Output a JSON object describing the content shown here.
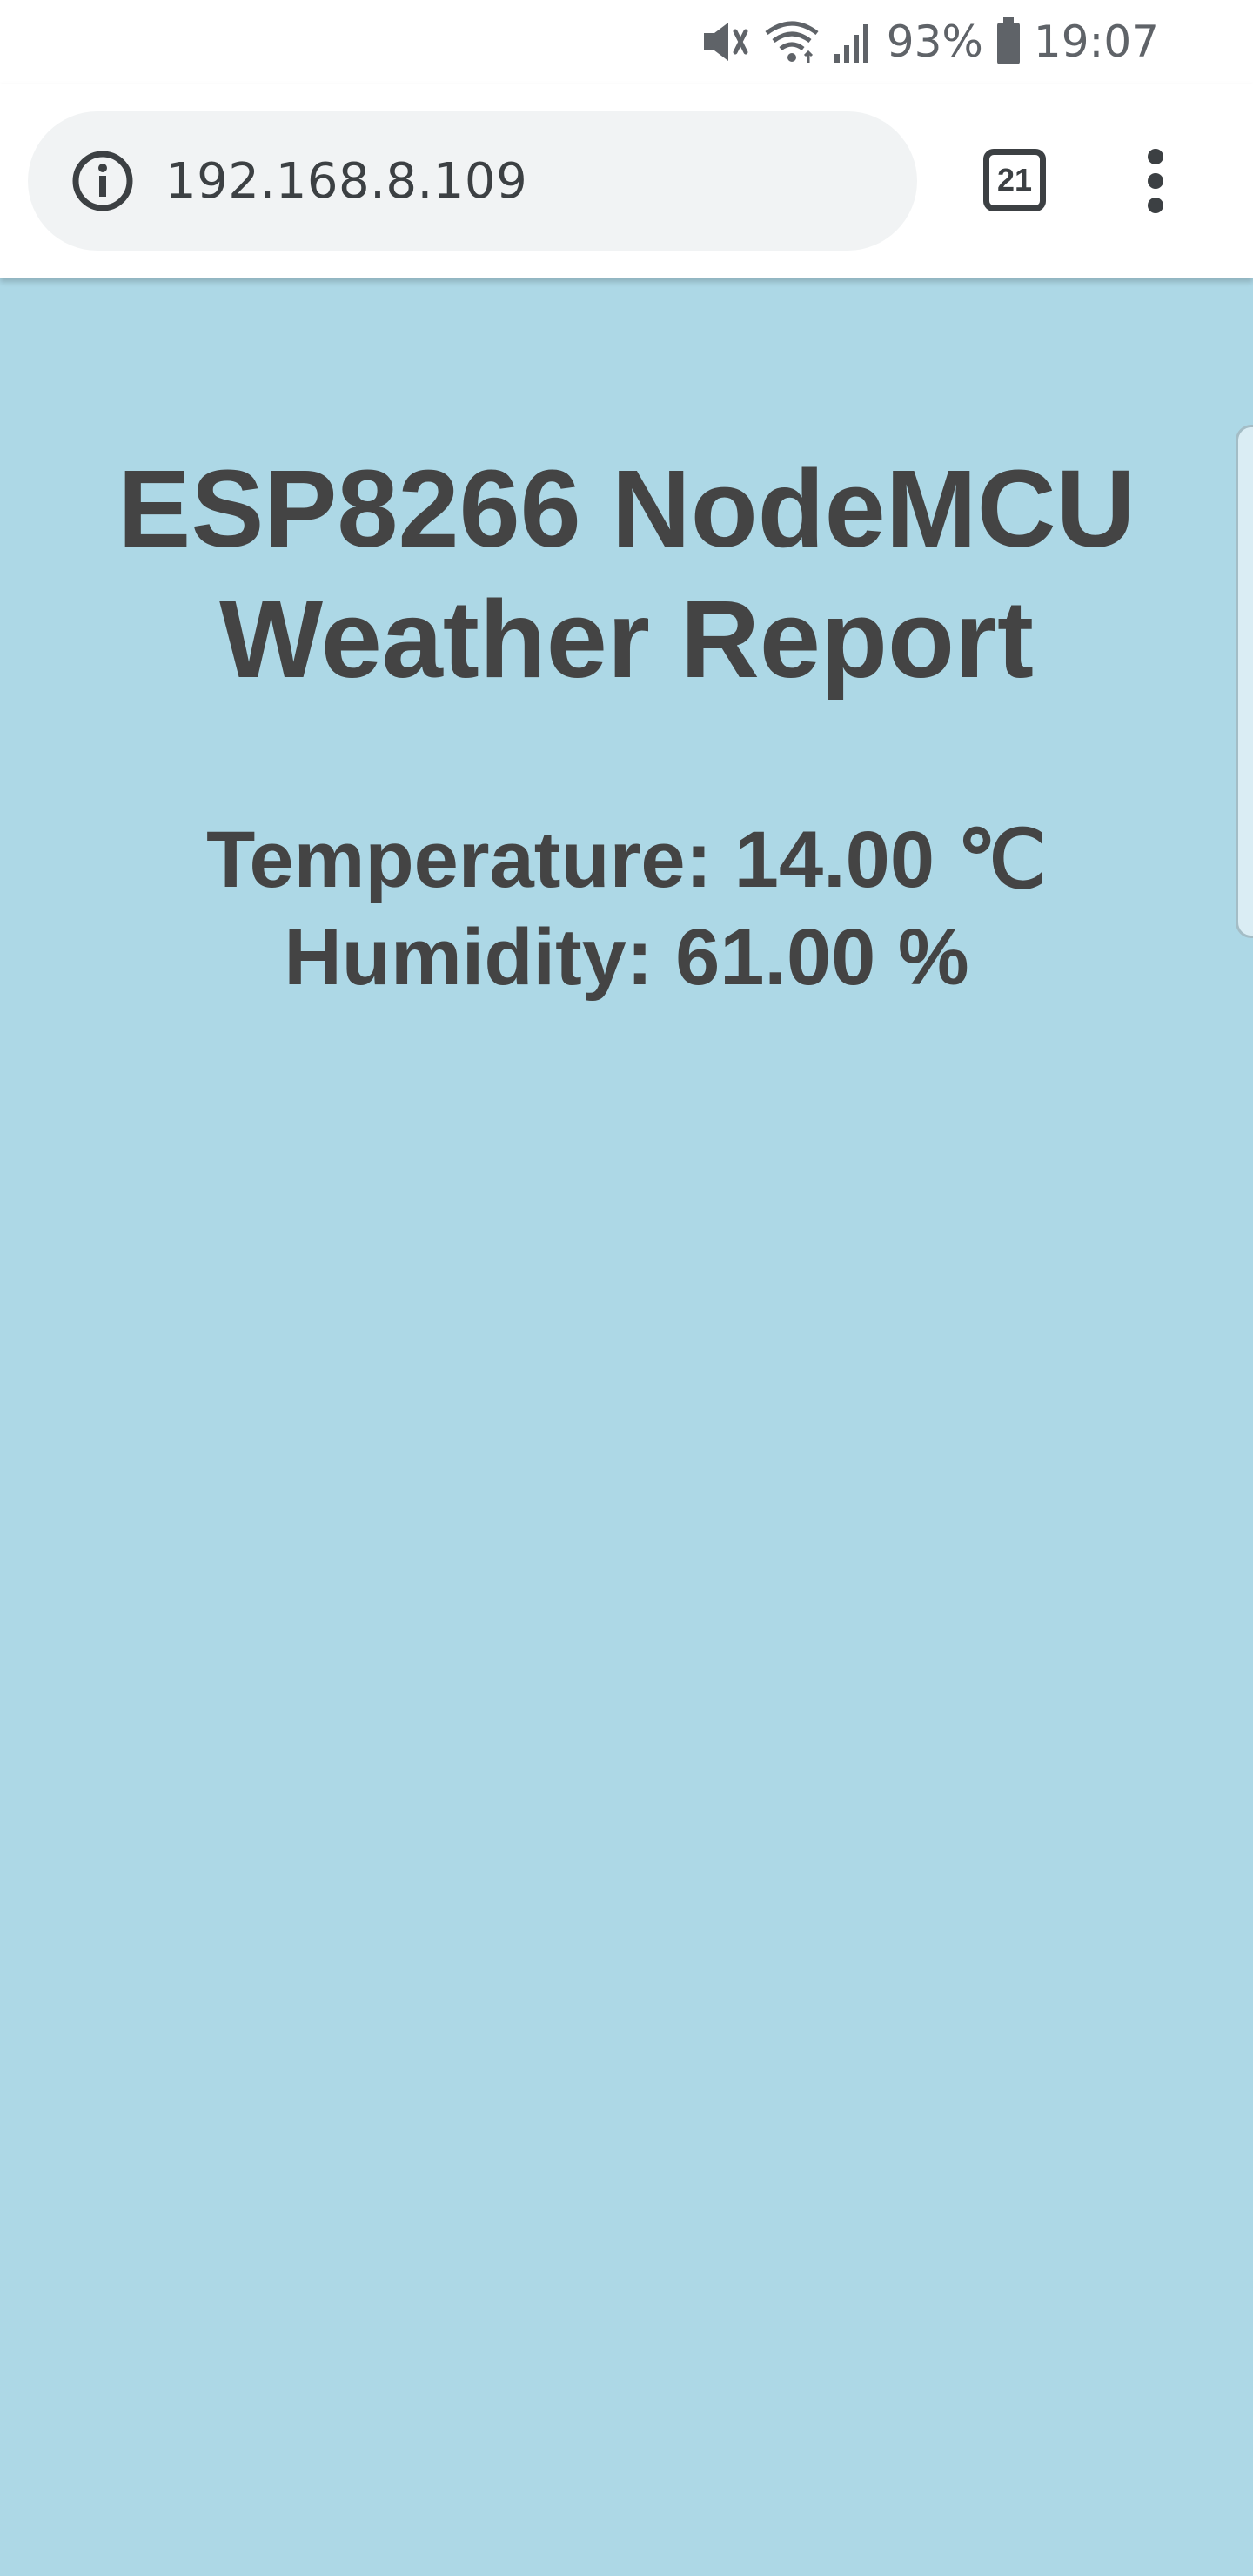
{
  "status_bar": {
    "battery_percent": "93%",
    "time": "19:07",
    "icons": [
      "mute-icon",
      "wifi-icon",
      "signal-icon",
      "battery-icon"
    ]
  },
  "browser": {
    "url": "192.168.8.109",
    "tab_count": "21",
    "menu_icon": "more-vert-icon",
    "site_info_icon": "info-icon"
  },
  "page": {
    "background_color": "#add8e6",
    "text_color": "#444444",
    "title_line1": "ESP8266 NodeMCU",
    "title_line2": "Weather Report",
    "temperature_text": "Temperature: 14.00 ℃",
    "humidity_text": "Humidity: 61.00 %"
  }
}
